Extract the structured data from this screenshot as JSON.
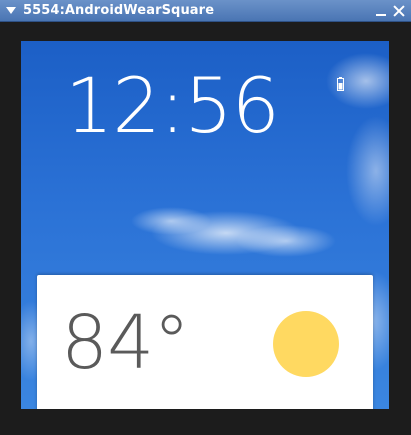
{
  "window": {
    "title": "5554:AndroidWearSquare",
    "menu_icon": "dropdown-arrow-icon",
    "minimize_icon": "minimize-icon",
    "close_icon": "close-icon"
  },
  "watch_face": {
    "time": "12:56",
    "battery_icon": "battery-icon",
    "background": "blue-sky-with-clouds"
  },
  "weather_card": {
    "temperature": "84°",
    "condition_icon": "sun-icon",
    "colors": {
      "card": "#ffffff",
      "sun": "#ffd961",
      "text": "#5a5a5a"
    }
  }
}
